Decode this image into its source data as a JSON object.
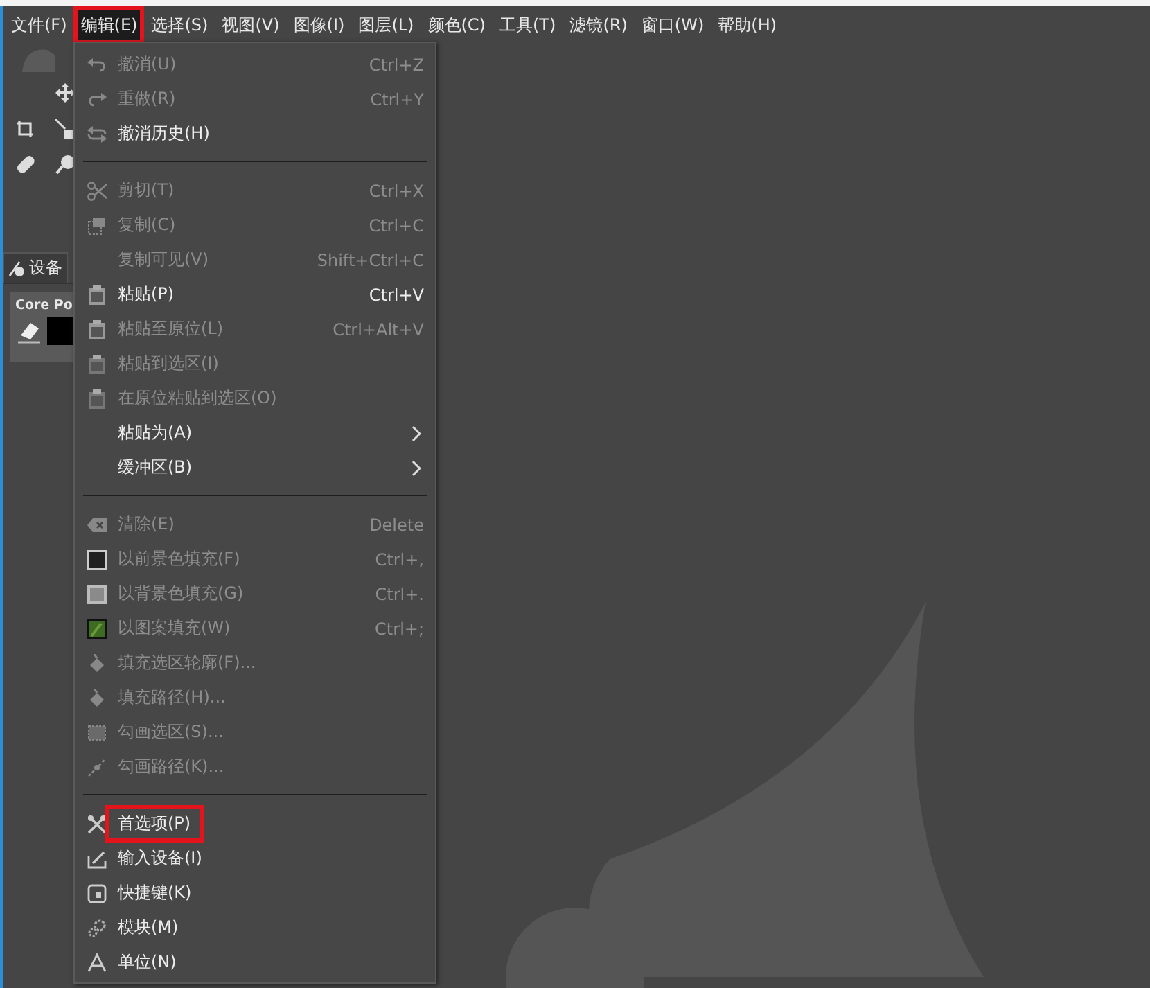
{
  "menubar": [
    {
      "label": "文件(F)",
      "selected": false,
      "annotated": false
    },
    {
      "label": "编辑(E)",
      "selected": true,
      "annotated": true
    },
    {
      "label": "选择(S)",
      "selected": false,
      "annotated": false
    },
    {
      "label": "视图(V)",
      "selected": false,
      "annotated": false
    },
    {
      "label": "图像(I)",
      "selected": false,
      "annotated": false
    },
    {
      "label": "图层(L)",
      "selected": false,
      "annotated": false
    },
    {
      "label": "颜色(C)",
      "selected": false,
      "annotated": false
    },
    {
      "label": "工具(T)",
      "selected": false,
      "annotated": false
    },
    {
      "label": "滤镜(R)",
      "selected": false,
      "annotated": false
    },
    {
      "label": "窗口(W)",
      "selected": false,
      "annotated": false
    },
    {
      "label": "帮助(H)",
      "selected": false,
      "annotated": false
    }
  ],
  "left_panel": {
    "tab_label": "设备",
    "device_name": "Core Po"
  },
  "edit_menu": [
    {
      "kind": "item",
      "label": "撤消(U)",
      "shortcut": "Ctrl+Z",
      "disabled": true,
      "submenu": false,
      "annotated": false
    },
    {
      "kind": "item",
      "label": "重做(R)",
      "shortcut": "Ctrl+Y",
      "disabled": true,
      "submenu": false,
      "annotated": false
    },
    {
      "kind": "item",
      "label": "撤消历史(H)",
      "disabled": false,
      "submenu": false,
      "annotated": false
    },
    {
      "kind": "separator"
    },
    {
      "kind": "item",
      "label": "剪切(T)",
      "shortcut": "Ctrl+X",
      "disabled": true,
      "submenu": false,
      "annotated": false
    },
    {
      "kind": "item",
      "label": "复制(C)",
      "shortcut": "Ctrl+C",
      "disabled": true,
      "submenu": false,
      "annotated": false
    },
    {
      "kind": "item",
      "label": "复制可见(V)",
      "shortcut": "Shift+Ctrl+C",
      "disabled": true,
      "submenu": false,
      "annotated": false
    },
    {
      "kind": "item",
      "label": "粘贴(P)",
      "shortcut": "Ctrl+V",
      "disabled": false,
      "submenu": false,
      "annotated": false
    },
    {
      "kind": "item",
      "label": "粘贴至原位(L)",
      "shortcut": "Ctrl+Alt+V",
      "disabled": true,
      "submenu": false,
      "annotated": false
    },
    {
      "kind": "item",
      "label": "粘贴到选区(I)",
      "disabled": true,
      "submenu": false,
      "annotated": false
    },
    {
      "kind": "item",
      "label": "在原位粘贴到选区(O)",
      "disabled": true,
      "submenu": false,
      "annotated": false
    },
    {
      "kind": "item",
      "label": "粘贴为(A)",
      "disabled": false,
      "submenu": true,
      "annotated": false
    },
    {
      "kind": "item",
      "label": "缓冲区(B)",
      "disabled": false,
      "submenu": true,
      "annotated": false
    },
    {
      "kind": "separator"
    },
    {
      "kind": "item",
      "label": "清除(E)",
      "shortcut": "Delete",
      "disabled": true,
      "submenu": false,
      "annotated": false
    },
    {
      "kind": "item",
      "label": "以前景色填充(F)",
      "shortcut": "Ctrl+,",
      "disabled": true,
      "submenu": false,
      "annotated": false
    },
    {
      "kind": "item",
      "label": "以背景色填充(G)",
      "shortcut": "Ctrl+.",
      "disabled": true,
      "submenu": false,
      "annotated": false
    },
    {
      "kind": "item",
      "label": "以图案填充(W)",
      "shortcut": "Ctrl+;",
      "disabled": true,
      "submenu": false,
      "annotated": false
    },
    {
      "kind": "item",
      "label": "填充选区轮廓(F)...",
      "disabled": true,
      "submenu": false,
      "annotated": false
    },
    {
      "kind": "item",
      "label": "填充路径(H)...",
      "disabled": true,
      "submenu": false,
      "annotated": false
    },
    {
      "kind": "item",
      "label": "勾画选区(S)...",
      "disabled": true,
      "submenu": false,
      "annotated": false
    },
    {
      "kind": "item",
      "label": "勾画路径(K)...",
      "disabled": true,
      "submenu": false,
      "annotated": false
    },
    {
      "kind": "separator"
    },
    {
      "kind": "item",
      "label": "首选项(P)",
      "disabled": false,
      "submenu": false,
      "annotated": true
    },
    {
      "kind": "item",
      "label": "输入设备(I)",
      "disabled": false,
      "submenu": false,
      "annotated": false
    },
    {
      "kind": "item",
      "label": "快捷键(K)",
      "disabled": false,
      "submenu": false,
      "annotated": false
    },
    {
      "kind": "item",
      "label": "模块(M)",
      "disabled": false,
      "submenu": false,
      "annotated": false
    },
    {
      "kind": "item",
      "label": "单位(N)",
      "disabled": false,
      "submenu": false,
      "annotated": false
    }
  ]
}
